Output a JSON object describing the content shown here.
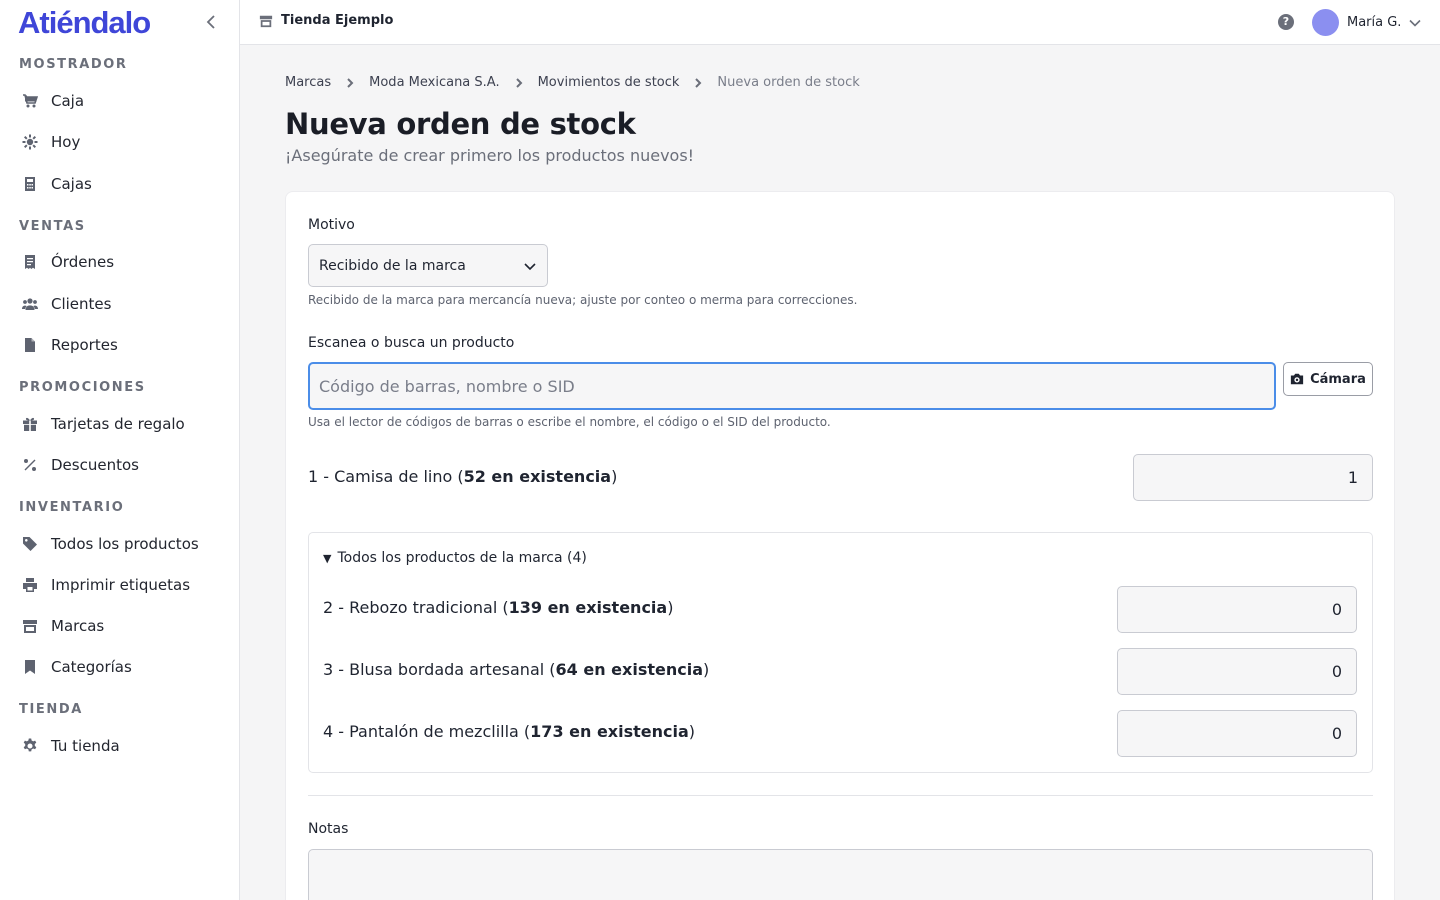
{
  "sidebar": {
    "brand": "Atiéndalo",
    "sections": [
      {
        "title": "MOSTRADOR",
        "items": [
          {
            "label": "Caja",
            "icon": "cart-icon"
          },
          {
            "label": "Hoy",
            "icon": "sun-icon"
          },
          {
            "label": "Cajas",
            "icon": "calculator-icon"
          }
        ]
      },
      {
        "title": "VENTAS",
        "items": [
          {
            "label": "Órdenes",
            "icon": "receipt-icon"
          },
          {
            "label": "Clientes",
            "icon": "users-icon"
          },
          {
            "label": "Reportes",
            "icon": "file-icon"
          }
        ]
      },
      {
        "title": "PROMOCIONES",
        "items": [
          {
            "label": "Tarjetas de regalo",
            "icon": "gift-icon"
          },
          {
            "label": "Descuentos",
            "icon": "percent-icon"
          }
        ]
      },
      {
        "title": "INVENTARIO",
        "items": [
          {
            "label": "Todos los productos",
            "icon": "tag-icon"
          },
          {
            "label": "Imprimir etiquetas",
            "icon": "printer-icon"
          },
          {
            "label": "Marcas",
            "icon": "store-icon"
          },
          {
            "label": "Categorías",
            "icon": "bookmark-icon"
          }
        ]
      },
      {
        "title": "TIENDA",
        "items": [
          {
            "label": "Tu tienda",
            "icon": "gear-icon"
          }
        ]
      }
    ]
  },
  "topbar": {
    "store_name": "Tienda Ejemplo",
    "help": "?",
    "user_name": "María G."
  },
  "breadcrumb": [
    "Marcas",
    "Moda Mexicana S.A.",
    "Movimientos de stock",
    "Nueva orden de stock"
  ],
  "page": {
    "title": "Nueva orden de stock",
    "subtitle": "¡Asegúrate de crear primero los productos nuevos!"
  },
  "form": {
    "motivo_label": "Motivo",
    "motivo_value": "Recibido de la marca",
    "motivo_help": "Recibido de la marca para mercancía nueva; ajuste por conteo o merma para correcciones.",
    "search_label": "Escanea o busca un producto",
    "search_placeholder": "Código de barras, nombre o SID",
    "camera_label": "Cámara",
    "search_help": "Usa el lector de códigos de barras o escribe el nombre, el código o el SID del producto.",
    "selected": {
      "prefix": "1 - Camisa de lino (",
      "stock": "52 en existencia",
      "suffix": ")",
      "qty": "1"
    },
    "brand_products_summary": "Todos los productos de la marca (4)",
    "brand_products": [
      {
        "prefix": "2 - Rebozo tradicional (",
        "stock": "139 en existencia",
        "suffix": ")",
        "qty": "0"
      },
      {
        "prefix": "3 - Blusa bordada artesanal (",
        "stock": "64 en existencia",
        "suffix": ")",
        "qty": "0"
      },
      {
        "prefix": "4 - Pantalón de mezclilla (",
        "stock": "173 en existencia",
        "suffix": ")",
        "qty": "0"
      }
    ],
    "notes_label": "Notas"
  },
  "colors": {
    "brand": "#3f46d8",
    "focus": "#4b8de8",
    "avatar": "#8b8ff0"
  }
}
